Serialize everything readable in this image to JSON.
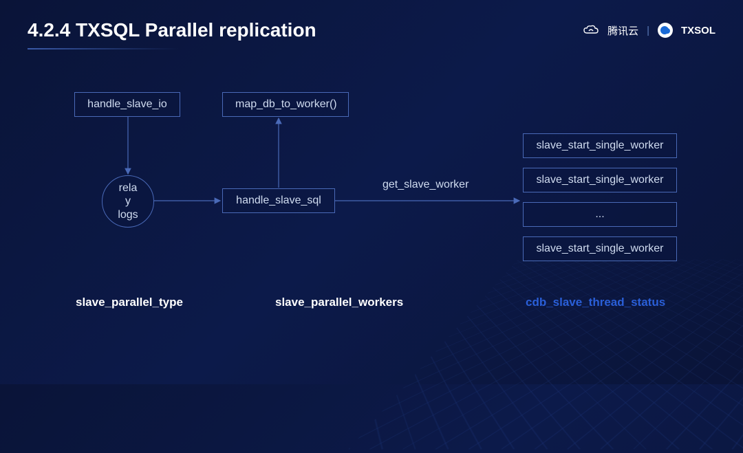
{
  "header": {
    "title": "4.2.4 TXSQL Parallel replication",
    "tencent_cloud_label": "腾讯云",
    "product_label": "TXSOL"
  },
  "diagram": {
    "handle_slave_io": "handle_slave_io",
    "map_db_to_worker": "map_db_to_worker()",
    "relay_logs_line1": "rela",
    "relay_logs_line2": "y",
    "relay_logs_line3": "logs",
    "handle_slave_sql": "handle_slave_sql",
    "get_slave_worker": "get_slave_worker",
    "workers": {
      "w1": "slave_start_single_worker",
      "w2": "slave_start_single_worker",
      "w3": "...",
      "w4": "slave_start_single_worker"
    }
  },
  "footer": {
    "left": "slave_parallel_type",
    "center": "slave_parallel_workers",
    "right": "cdb_slave_thread_status"
  },
  "chart_data": {
    "type": "diagram",
    "title": "4.2.4 TXSQL Parallel replication",
    "nodes": [
      {
        "id": "handle_slave_io",
        "label": "handle_slave_io",
        "shape": "box"
      },
      {
        "id": "relay_logs",
        "label": "relay logs",
        "shape": "circle"
      },
      {
        "id": "handle_slave_sql",
        "label": "handle_slave_sql",
        "shape": "box"
      },
      {
        "id": "map_db_to_worker",
        "label": "map_db_to_worker()",
        "shape": "box"
      },
      {
        "id": "worker_1",
        "label": "slave_start_single_worker",
        "shape": "box"
      },
      {
        "id": "worker_2",
        "label": "slave_start_single_worker",
        "shape": "box"
      },
      {
        "id": "worker_ellipsis",
        "label": "...",
        "shape": "box"
      },
      {
        "id": "worker_n",
        "label": "slave_start_single_worker",
        "shape": "box"
      }
    ],
    "edges": [
      {
        "from": "handle_slave_io",
        "to": "relay_logs",
        "label": ""
      },
      {
        "from": "relay_logs",
        "to": "handle_slave_sql",
        "label": ""
      },
      {
        "from": "handle_slave_sql",
        "to": "map_db_to_worker",
        "label": ""
      },
      {
        "from": "handle_slave_sql",
        "to": "worker_1",
        "label": "get_slave_worker",
        "fan_out": true
      },
      {
        "from": "handle_slave_sql",
        "to": "worker_2",
        "label": "get_slave_worker",
        "fan_out": true
      },
      {
        "from": "handle_slave_sql",
        "to": "worker_ellipsis",
        "label": "get_slave_worker",
        "fan_out": true
      },
      {
        "from": "handle_slave_sql",
        "to": "worker_n",
        "label": "get_slave_worker",
        "fan_out": true
      }
    ],
    "annotations": [
      {
        "text": "slave_parallel_type",
        "position": "bottom-left",
        "color": "#ffffff"
      },
      {
        "text": "slave_parallel_workers",
        "position": "bottom-center",
        "color": "#ffffff"
      },
      {
        "text": "cdb_slave_thread_status",
        "position": "bottom-right",
        "color": "#2a5fd8"
      }
    ]
  }
}
